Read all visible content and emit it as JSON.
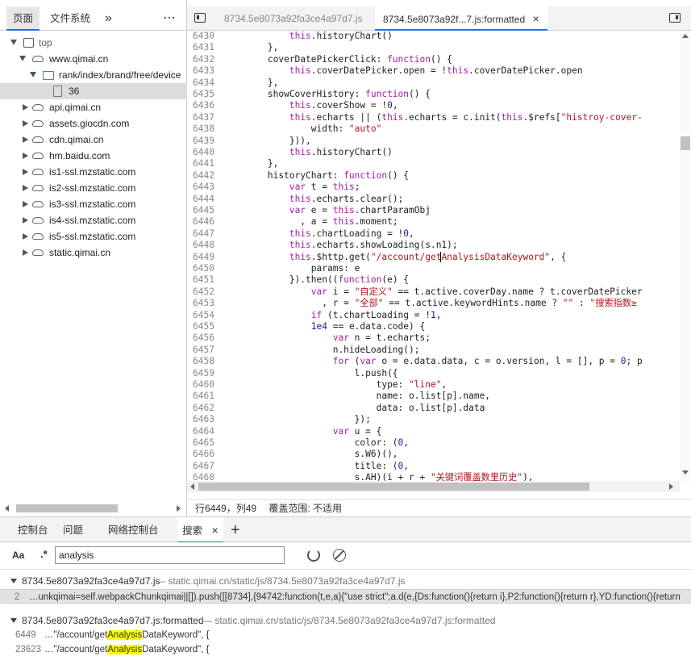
{
  "left_tabs": {
    "page": "页面",
    "filesystem": "文件系统",
    "more": "»",
    "menu": "⋯"
  },
  "tree": [
    {
      "label": "top"
    },
    {
      "label": "www.qimai.cn"
    },
    {
      "label": "rank/index/brand/free/device"
    },
    {
      "label": "36"
    },
    {
      "label": "api.qimai.cn"
    },
    {
      "label": "assets.giocdn.com"
    },
    {
      "label": "cdn.qimai.cn"
    },
    {
      "label": "hm.baidu.com"
    },
    {
      "label": "is1-ssl.mzstatic.com"
    },
    {
      "label": "is2-ssl.mzstatic.com"
    },
    {
      "label": "is3-ssl.mzstatic.com"
    },
    {
      "label": "is4-ssl.mzstatic.com"
    },
    {
      "label": "is5-ssl.mzstatic.com"
    },
    {
      "label": "static.qimai.cn"
    }
  ],
  "editor_tabs": {
    "tab1": "8734.5e8073a92fa3ce4a97d7.js",
    "tab2": "8734.5e8073a92f...7.js:formatted",
    "close": "×"
  },
  "code": [
    {
      "n": "6430"
    },
    {
      "n": "6431"
    },
    {
      "n": "6432"
    },
    {
      "n": "6433"
    },
    {
      "n": "6434"
    },
    {
      "n": "6435"
    },
    {
      "n": "6436"
    },
    {
      "n": "6437"
    },
    {
      "n": "6438"
    },
    {
      "n": "6439"
    },
    {
      "n": "6440"
    },
    {
      "n": "6441"
    },
    {
      "n": "6442"
    },
    {
      "n": "6443"
    },
    {
      "n": "6444"
    },
    {
      "n": "6445"
    },
    {
      "n": "6446"
    },
    {
      "n": "6447"
    },
    {
      "n": "6448"
    },
    {
      "n": "6449"
    },
    {
      "n": "6450"
    },
    {
      "n": "6451"
    },
    {
      "n": "6452"
    },
    {
      "n": "6453"
    },
    {
      "n": "6454"
    },
    {
      "n": "6455"
    },
    {
      "n": "6456"
    },
    {
      "n": "6457"
    },
    {
      "n": "6458"
    },
    {
      "n": "6459"
    },
    {
      "n": "6460"
    },
    {
      "n": "6461"
    },
    {
      "n": "6462"
    },
    {
      "n": "6463"
    },
    {
      "n": "6464"
    },
    {
      "n": "6465"
    },
    {
      "n": "6466"
    },
    {
      "n": "6467"
    },
    {
      "n": "6468"
    }
  ],
  "status": {
    "position": "行6449，列49",
    "coverage": "覆盖范围: 不适用"
  },
  "drawer_tabs": {
    "console": "控制台",
    "issues": "问题",
    "network_console": "网络控制台",
    "search": "搜索",
    "close": "×",
    "add": "+"
  },
  "search": {
    "case_label": "Aa",
    "regex_label": ".*",
    "query": "analysis"
  },
  "results": {
    "file1_name": "8734.5e8073a92fa3ce4a97d7.js",
    "file1_path": "— static.qimai.cn/static/js/8734.5e8073a92fa3ce4a97d7.js",
    "file1_line_no": "2",
    "file1_line_text": "…unkqimai=self.webpackChunkqimai||[]).push([[8734],{94742:function(t,e,a){\"use strict\";a.d(e,{Ds:function(){return i},P2:function(){return r},YD:function(){return",
    "file2_name": "8734.5e8073a92fa3ce4a97d7.js:formatted",
    "file2_path": "— static.qimai.cn/static/js/8734.5e8073a92fa3ce4a97d7.js:formatted",
    "match1_no": "6449",
    "match1_pre": "…\"/account/get",
    "match1_hl": "Analysis",
    "match1_post": "DataKeyword\", {",
    "match2_no": "23623",
    "match2_pre": "…\"/account/get",
    "match2_hl": "Analysis",
    "match2_post": "DataKeyword\", {"
  }
}
